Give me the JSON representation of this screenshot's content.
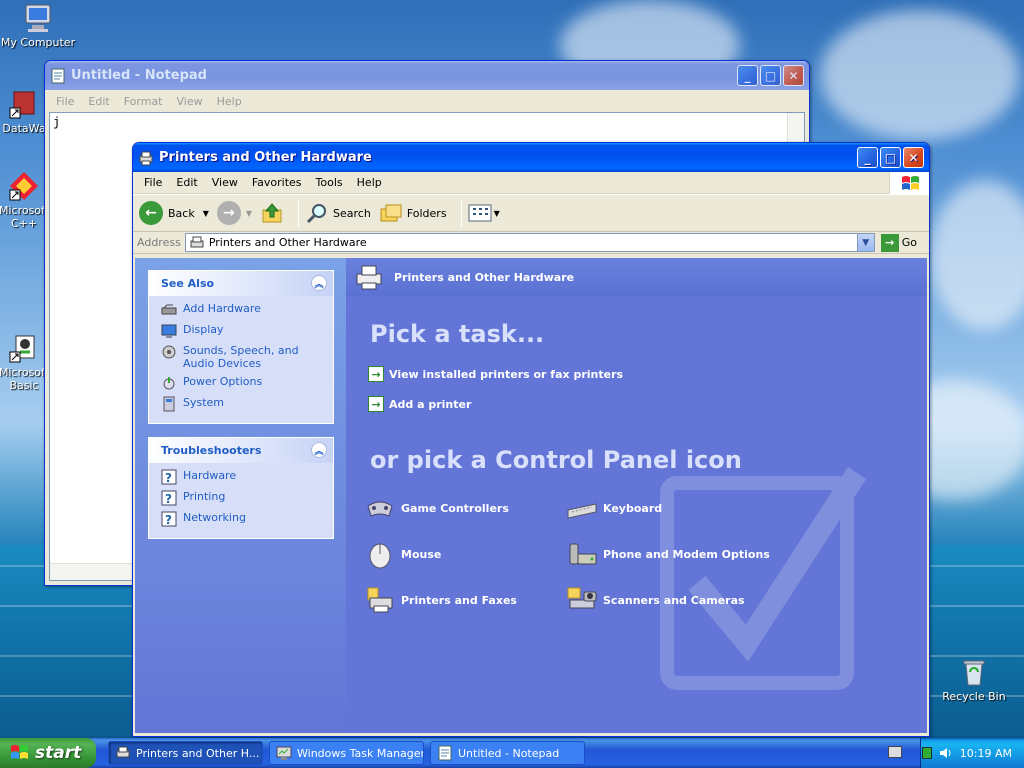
{
  "desktop": {
    "icons": [
      {
        "label": "My Computer"
      },
      {
        "label": "DataWa"
      },
      {
        "label": "Microsoft C++"
      },
      {
        "label": "Microsoft Basic"
      },
      {
        "label": "Recycle Bin"
      }
    ]
  },
  "notepad": {
    "title": "Untitled - Notepad",
    "menu": [
      "File",
      "Edit",
      "Format",
      "View",
      "Help"
    ],
    "text": "j"
  },
  "explorer": {
    "title": "Printers and Other Hardware",
    "menu": [
      "File",
      "Edit",
      "View",
      "Favorites",
      "Tools",
      "Help"
    ],
    "toolbar": {
      "back": "Back",
      "search": "Search",
      "folders": "Folders"
    },
    "address": {
      "label": "Address",
      "value": "Printers and Other Hardware",
      "go": "Go"
    },
    "see_also": {
      "title": "See Also",
      "items": [
        "Add Hardware",
        "Display",
        "Sounds, Speech, and Audio Devices",
        "Power Options",
        "System"
      ]
    },
    "troubleshooters": {
      "title": "Troubleshooters",
      "items": [
        "Hardware",
        "Printing",
        "Networking"
      ]
    },
    "header": "Printers and Other Hardware",
    "pick_task": "Pick a task...",
    "tasks": [
      "View installed printers or fax printers",
      "Add a printer"
    ],
    "pick_icon": "or pick a Control Panel icon",
    "icons": [
      "Game Controllers",
      "Keyboard",
      "Mouse",
      "Phone and Modem Options",
      "Printers and Faxes",
      "Scanners and Cameras"
    ]
  },
  "taskbar": {
    "start": "start",
    "buttons": [
      "Printers and Other H...",
      "Windows Task Manager",
      "Untitled - Notepad"
    ],
    "clock": "10:19 AM"
  }
}
